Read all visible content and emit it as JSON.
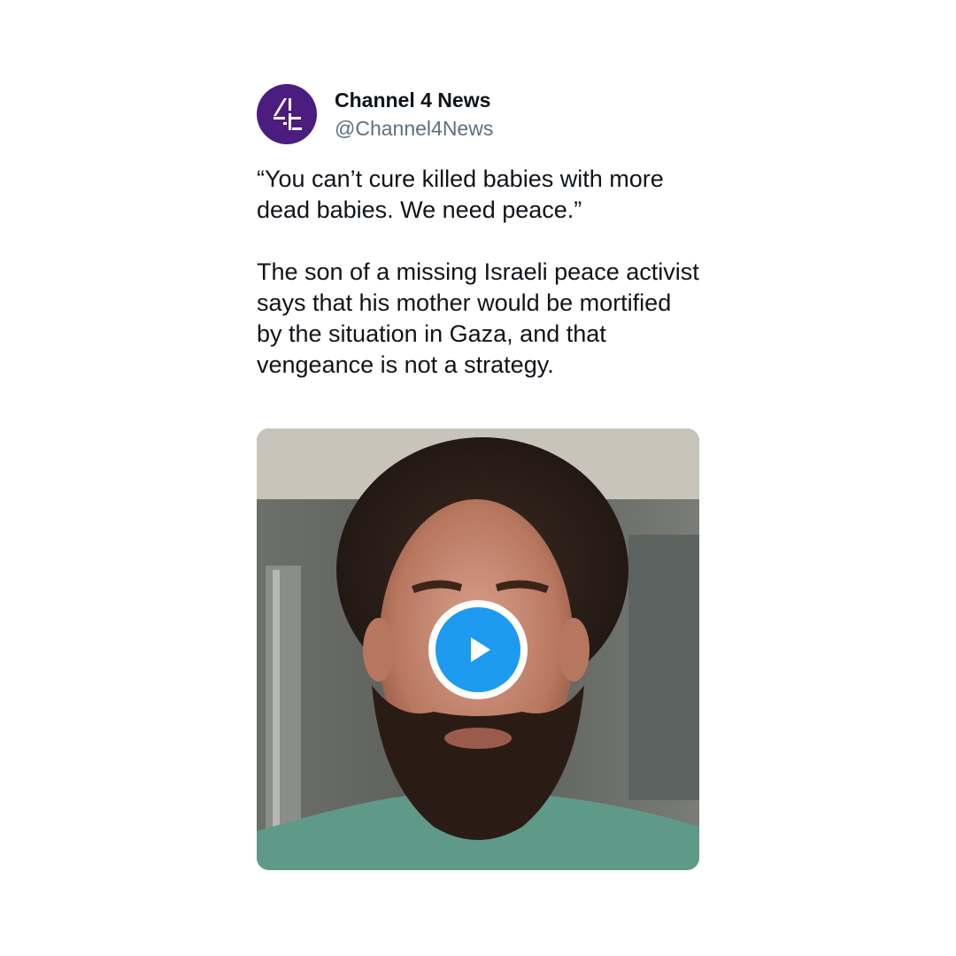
{
  "tweet": {
    "author": {
      "display_name": "Channel 4 News",
      "handle": "@Channel4News",
      "avatar_icon": "channel-4-logo-icon",
      "avatar_color": "#4b1d7e"
    },
    "quote": "“You can’t cure killed babies with more dead babies. We need peace.”",
    "body": "The son of a missing Israeli peace activist says that his mother would be mortified by the situation in Gaza, and that vengeance is not a strategy.",
    "media": {
      "type": "video",
      "play_icon": "play-icon",
      "play_color": "#1d9bf0"
    }
  }
}
